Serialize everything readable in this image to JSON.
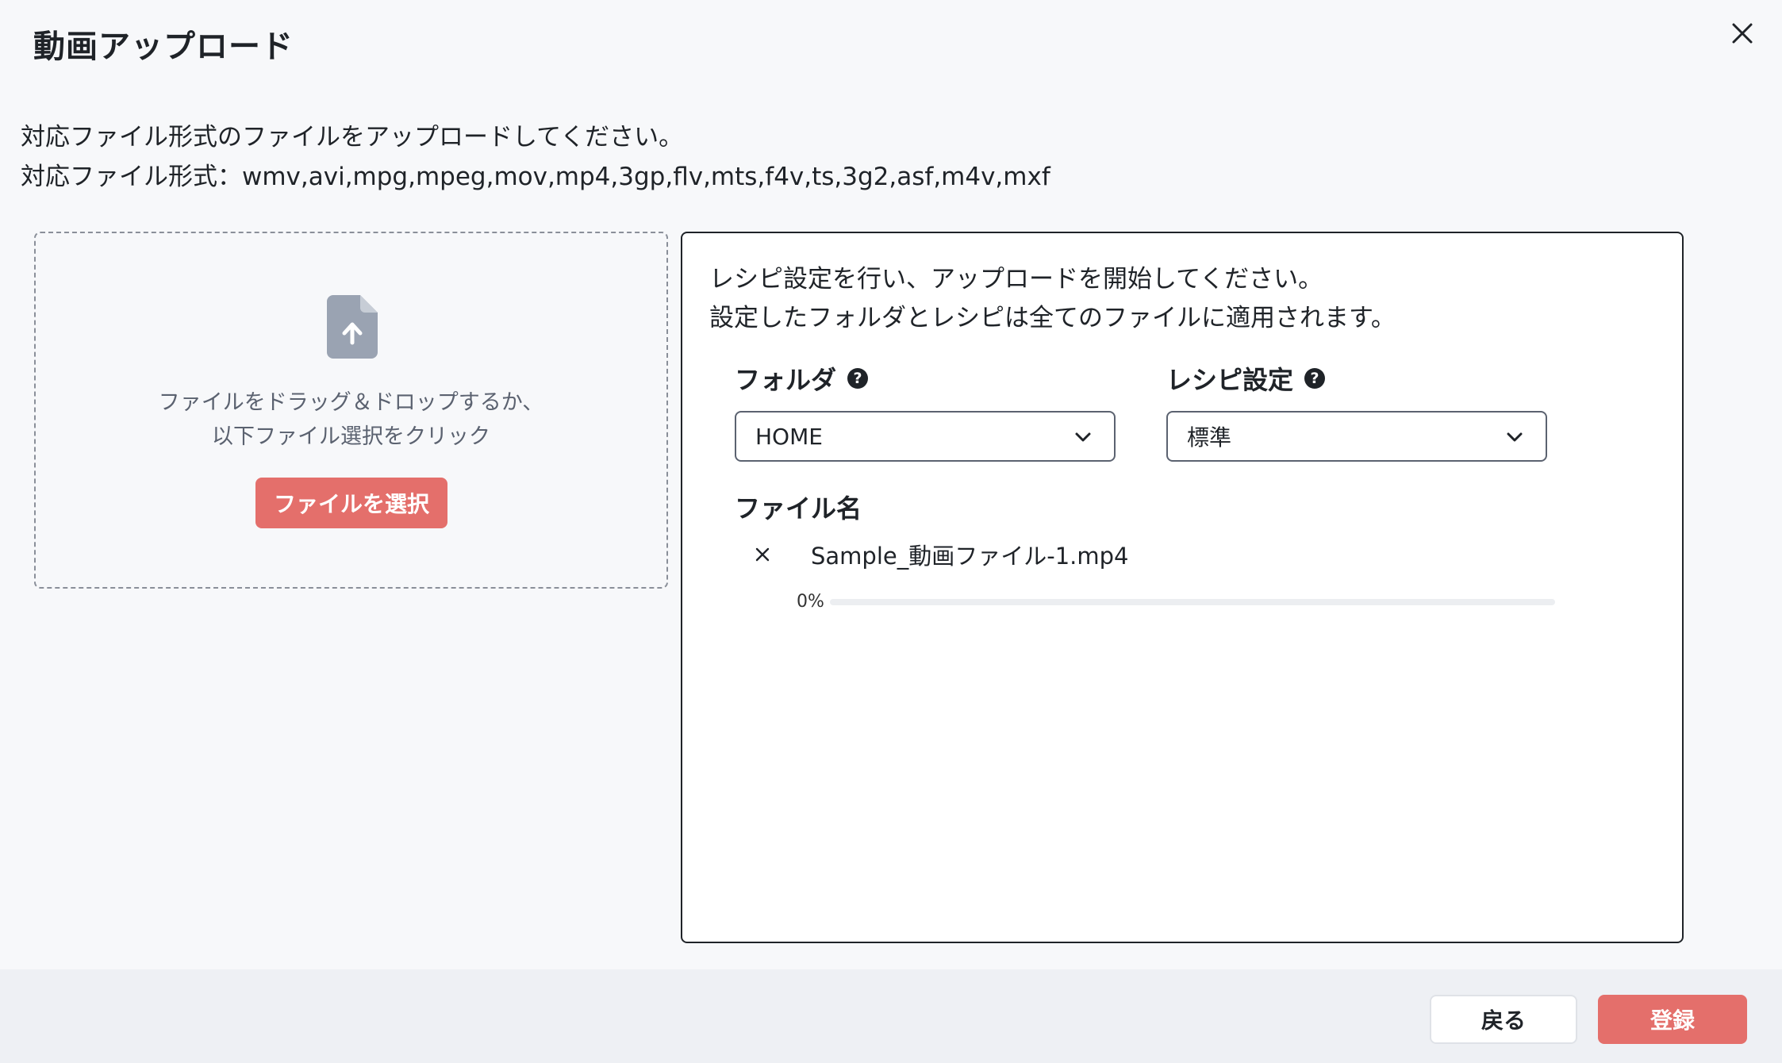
{
  "dialog": {
    "title": "動画アップロード",
    "close_icon": "close-icon"
  },
  "intro": {
    "line1": "対応ファイル形式のファイルをアップロードしてください。",
    "line2": "対応ファイル形式：wmv,avi,mpg,mpeg,mov,mp4,3gp,flv,mts,f4v,ts,3g2,asf,m4v,mxf"
  },
  "dropzone": {
    "icon": "file-upload-icon",
    "text_line1": "ファイルをドラッグ＆ドロップするか、",
    "text_line2": "以下ファイル選択をクリック",
    "button_label": "ファイルを選択"
  },
  "settings": {
    "desc_line1": "レシピ設定を行い、アップロードを開始してください。",
    "desc_line2": "設定したフォルダとレシピは全てのファイルに適用されます。",
    "folder": {
      "label": "フォルダ",
      "help_icon": "help-icon",
      "value": "HOME"
    },
    "recipe": {
      "label": "レシピ設定",
      "help_icon": "help-icon",
      "value": "標準"
    },
    "files_label": "ファイル名",
    "files": [
      {
        "name": "Sample_動画ファイル-1.mp4",
        "progress_text": "0%",
        "progress": 0
      }
    ]
  },
  "footer": {
    "back_label": "戻る",
    "register_label": "登録"
  },
  "colors": {
    "accent": "#e46f6b",
    "text": "#1f2328",
    "muted": "#5b6270",
    "background": "#f7f8fa"
  }
}
